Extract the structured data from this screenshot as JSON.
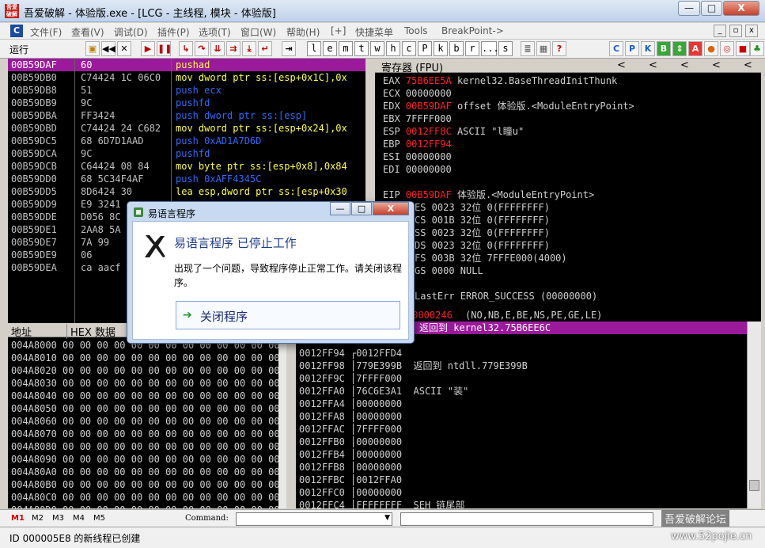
{
  "window": {
    "title": "吾爱破解 - 体验版.exe - [LCG - 主线程, 模块 - 体验版]",
    "icon_text": "吾爱破解",
    "minimize": "—",
    "maximize": "□",
    "close": "X"
  },
  "menu": {
    "items": [
      "文件(F)",
      "查看(V)",
      "调试(D)",
      "插件(P)",
      "选项(T)",
      "窗口(W)",
      "帮助(H)",
      "[+]",
      "快捷菜单",
      "Tools",
      "BreakPoint->"
    ],
    "mdi": [
      "_",
      "▫",
      "x"
    ]
  },
  "toolbar": {
    "status": "运行",
    "letters": [
      "l",
      "e",
      "m",
      "t",
      "w",
      "h",
      "c",
      "P",
      "k",
      "b",
      "r",
      "...",
      "s"
    ]
  },
  "cpu": {
    "addresses": [
      "00B59DAF",
      "00B59DB0",
      "00B59DB8",
      "00B59DB9",
      "00B59DBA",
      "00B59DBD",
      "00B59DC5",
      "00B59DCA",
      "00B59DCB",
      "00B59DD0",
      "00B59DD5",
      "00B59DD9",
      "00B59DDE",
      "00B59DE1",
      "00B59DE7",
      "00B59DE9",
      "00B59DEA"
    ],
    "hex": [
      "60",
      "C74424 1C 06C0",
      "51",
      "9C",
      "FF3424",
      "C74424 24 C682",
      "68 6D7D1AAD",
      "9C",
      "C64424 08 84",
      "68 5C34F4AF",
      "8D6424 30",
      "E9 3241",
      "D056 8C",
      "2AA8 5A",
      "7A 99",
      "06",
      "ca aacf"
    ],
    "disasm": [
      "pushad",
      "mov dword ptr ss:[esp+0x1C],0x",
      "push ecx",
      "pushfd",
      "push dword ptr ss:[esp]",
      "mov dword ptr ss:[esp+0x24],0x",
      "push 0xAD1A7D6D",
      "pushfd",
      "mov byte ptr ss:[esp+0x8],0x84",
      "push 0xAFF4345C",
      "lea esp,dword ptr ss:[esp+0x30"
    ]
  },
  "registers": {
    "title": "寄存器 (FPU)",
    "arrows": [
      "<",
      "<",
      "<",
      "<",
      "<"
    ],
    "rows": [
      {
        "name": "EAX",
        "value": "75B6EE5A",
        "comment": "kernel32.BaseThreadInitThunk",
        "changed": true
      },
      {
        "name": "ECX",
        "value": "00000000",
        "comment": "",
        "changed": false
      },
      {
        "name": "EDX",
        "value": "00B59DAF",
        "comment": "offset 体验版.<ModuleEntryPoint>",
        "changed": true
      },
      {
        "name": "EBX",
        "value": "7FFFF000",
        "comment": "",
        "changed": false
      },
      {
        "name": "ESP",
        "value": "0012FF8C",
        "comment": "ASCII \"l瞳u\"",
        "changed": true
      },
      {
        "name": "EBP",
        "value": "0012FF94",
        "comment": "",
        "changed": true
      },
      {
        "name": "ESI",
        "value": "00000000",
        "comment": "",
        "changed": false
      },
      {
        "name": "EDI",
        "value": "00000000",
        "comment": "",
        "changed": false
      },
      {
        "name": "",
        "value": "",
        "comment": "",
        "changed": false
      },
      {
        "name": "EIP",
        "value": "00B59DAF",
        "comment": "体验版.<ModuleEntryPoint>",
        "changed": true
      }
    ],
    "segments": [
      "ES 0023 32位 0(FFFFFFFF)",
      "CS 001B 32位 0(FFFFFFFF)",
      "SS 0023 32位 0(FFFFFFFF)",
      "DS 0023 32位 0(FFFFFFFF)",
      "FS 003B 32位 7FFFE000(4000)",
      "GS 0000 NULL"
    ],
    "lasterr": "LastErr ERROR_SUCCESS (00000000)",
    "eflags_value": "00000246",
    "eflags_comment": "(NO,NB,E,BE,NS,PE,GE,LE)"
  },
  "dump": {
    "header_addr": "地址",
    "header_hex": "HEX 数据",
    "rows": [
      "004A8000",
      "004A8010",
      "004A8020",
      "004A8030",
      "004A8040",
      "004A8050",
      "004A8060",
      "004A8070",
      "004A8080",
      "004A8090",
      "004A80A0",
      "004A80B0",
      "004A80C0",
      "004A80D0"
    ],
    "bytes": "00 00 00 00 00 00 00 00 00 00 00 00 00 00 00 00"
  },
  "stack": {
    "top_comment": "返回到 kernel32.75B6EE6C",
    "rows": [
      {
        "addr": "",
        "val": "",
        "comment": ""
      },
      {
        "addr": "0012FF94",
        "val": "┌0012FFD4",
        "comment": ""
      },
      {
        "addr": "0012FF98",
        "val": "│779E399B",
        "comment": "返回到 ntdll.779E399B"
      },
      {
        "addr": "0012FF9C",
        "val": "│7FFFF000",
        "comment": ""
      },
      {
        "addr": "0012FFA0",
        "val": "│76C6E3A1",
        "comment": "ASCII \"装\""
      },
      {
        "addr": "0012FFA4",
        "val": "│00000000",
        "comment": ""
      },
      {
        "addr": "0012FFA8",
        "val": "│00000000",
        "comment": ""
      },
      {
        "addr": "0012FFAC",
        "val": "│7FFFF000",
        "comment": ""
      },
      {
        "addr": "0012FFB0",
        "val": "│00000000",
        "comment": ""
      },
      {
        "addr": "0012FFB4",
        "val": "│00000000",
        "comment": ""
      },
      {
        "addr": "0012FFB8",
        "val": "│00000000",
        "comment": ""
      },
      {
        "addr": "0012FFBC",
        "val": "│0012FFA0",
        "comment": ""
      },
      {
        "addr": "0012FFC0",
        "val": "│00000000",
        "comment": ""
      },
      {
        "addr": "0012FFC4",
        "val": "│FFFFFFFF",
        "comment": "SEH 链尾部"
      }
    ]
  },
  "command": {
    "tabs": [
      "M1",
      "M2",
      "M3",
      "M4",
      "M5"
    ],
    "label": "Command:"
  },
  "status": {
    "text": "ID 000005E8 的新线程已创建"
  },
  "watermark": {
    "line1": "吾爱破解论坛",
    "line2": "www.52pojie.cn"
  },
  "dialog": {
    "title": "易语言程序",
    "heading": "易语言程序 已停止工作",
    "message": "出现了一个问题，导致程序停止正常工作。请关闭该程序。",
    "action": "关闭程序",
    "minimize": "—",
    "maximize": "□",
    "close": "X"
  },
  "colors": {
    "highlight": "#9b1a9b",
    "changed": "#ff2020",
    "disasm_blue": "#2c6bff",
    "disasm_yellow": "#ffff40"
  }
}
